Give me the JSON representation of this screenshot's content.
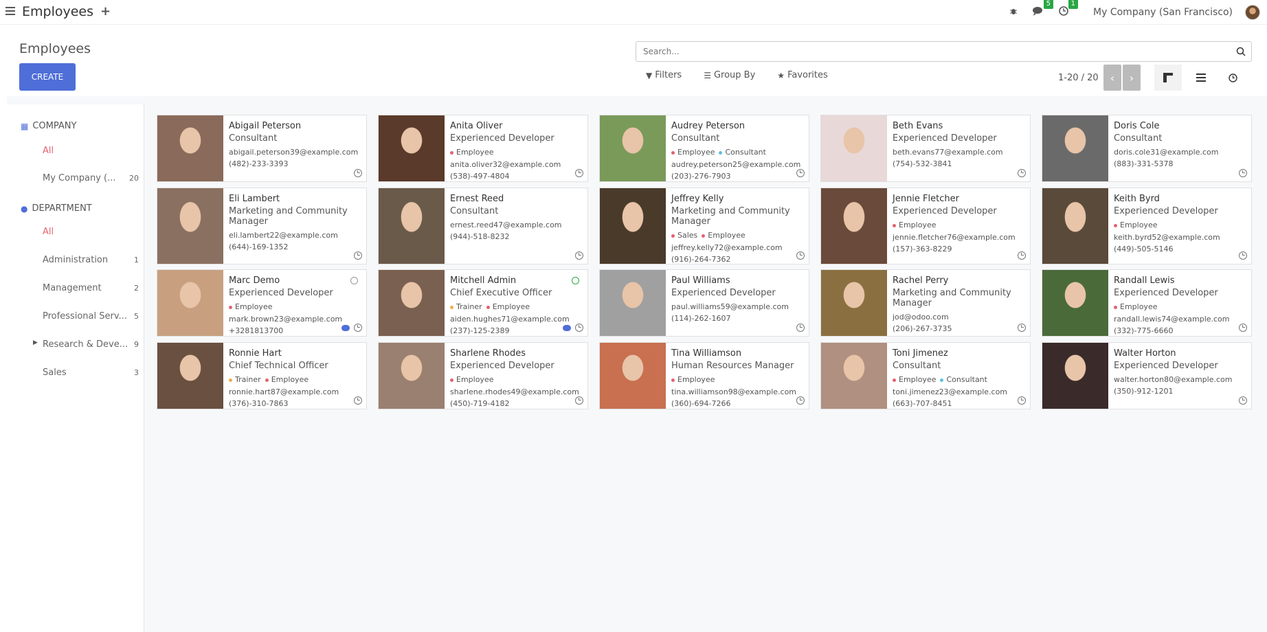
{
  "topbar": {
    "app_title": "Employees",
    "messages_badge": "5",
    "activities_badge": "1",
    "company": "My Company (San Francisco)"
  },
  "control": {
    "title": "Employees",
    "create_label": "CREATE",
    "search_placeholder": "Search...",
    "filters_label": "Filters",
    "groupby_label": "Group By",
    "favorites_label": "Favorites",
    "pager": "1-20 / 20"
  },
  "sidebar": {
    "company_head": "COMPANY",
    "company_all": "All",
    "company_item": "My Company (...",
    "company_item_count": "20",
    "department_head": "DEPARTMENT",
    "department_all": "All",
    "departments": [
      {
        "label": "Administration",
        "count": "1"
      },
      {
        "label": "Management",
        "count": "2"
      },
      {
        "label": "Professional Serv...",
        "count": "5"
      },
      {
        "label": "Research & Deve...",
        "count": "9"
      },
      {
        "label": "Sales",
        "count": "3"
      }
    ]
  },
  "colors": {
    "accent": "#4f6ed8",
    "active": "#e4626f",
    "tag_employee": "#e4626f",
    "tag_consultant": "#5bc0de",
    "tag_sales": "#e4626f",
    "tag_trainer": "#f0ad4e"
  },
  "employees": [
    {
      "name": "Abigail Peterson",
      "job": "Consultant",
      "tags": [],
      "email": "abigail.peterson39@example.com",
      "phone": "(482)-233-3393",
      "photo_color": "#8a6a5a"
    },
    {
      "name": "Anita Oliver",
      "job": "Experienced Developer",
      "tags": [
        {
          "label": "Employee",
          "color": "#e4626f"
        }
      ],
      "email": "anita.oliver32@example.com",
      "phone": "(538)-497-4804",
      "photo_color": "#5a3a2a"
    },
    {
      "name": "Audrey Peterson",
      "job": "Consultant",
      "tags": [
        {
          "label": "Employee",
          "color": "#e4626f"
        },
        {
          "label": "Consultant",
          "color": "#5bc0de"
        }
      ],
      "email": "audrey.peterson25@example.com",
      "phone": "(203)-276-7903",
      "photo_color": "#7a9a5a"
    },
    {
      "name": "Beth Evans",
      "job": "Experienced Developer",
      "tags": [],
      "email": "beth.evans77@example.com",
      "phone": "(754)-532-3841",
      "photo_color": "#e8d8d8"
    },
    {
      "name": "Doris Cole",
      "job": "Consultant",
      "tags": [],
      "email": "doris.cole31@example.com",
      "phone": "(883)-331-5378",
      "photo_color": "#6a6a6a"
    },
    {
      "name": "Eli Lambert",
      "job": "Marketing and Community Manager",
      "tags": [],
      "email": "eli.lambert22@example.com",
      "phone": "(644)-169-1352",
      "photo_color": "#8a7060"
    },
    {
      "name": "Ernest Reed",
      "job": "Consultant",
      "tags": [],
      "email": "ernest.reed47@example.com",
      "phone": "(944)-518-8232",
      "photo_color": "#6a5a4a"
    },
    {
      "name": "Jeffrey Kelly",
      "job": "Marketing and Community Manager",
      "tags": [
        {
          "label": "Sales",
          "color": "#e4626f"
        },
        {
          "label": "Employee",
          "color": "#e4626f"
        }
      ],
      "email": "jeffrey.kelly72@example.com",
      "phone": "(916)-264-7362",
      "photo_color": "#4a3a2a"
    },
    {
      "name": "Jennie Fletcher",
      "job": "Experienced Developer",
      "tags": [
        {
          "label": "Employee",
          "color": "#e4626f"
        }
      ],
      "email": "jennie.fletcher76@example.com",
      "phone": "(157)-363-8229",
      "photo_color": "#6a4a3a"
    },
    {
      "name": "Keith Byrd",
      "job": "Experienced Developer",
      "tags": [
        {
          "label": "Employee",
          "color": "#e4626f"
        }
      ],
      "email": "keith.byrd52@example.com",
      "phone": "(449)-505-5146",
      "photo_color": "#5a4a3a"
    },
    {
      "name": "Marc Demo",
      "job": "Experienced Developer",
      "tags": [
        {
          "label": "Employee",
          "color": "#e4626f"
        }
      ],
      "email": "mark.brown23@example.com",
      "phone": "+3281813700",
      "photo_color": "#c8a080",
      "status": "offline",
      "chat": true
    },
    {
      "name": "Mitchell Admin",
      "job": "Chief Executive Officer",
      "tags": [
        {
          "label": "Trainer",
          "color": "#f0ad4e"
        },
        {
          "label": "Employee",
          "color": "#e4626f"
        }
      ],
      "email": "aiden.hughes71@example.com",
      "phone": "(237)-125-2389",
      "photo_color": "#7a6050",
      "status": "online",
      "chat": true
    },
    {
      "name": "Paul Williams",
      "job": "Experienced Developer",
      "tags": [],
      "email": "paul.williams59@example.com",
      "phone": "(114)-262-1607",
      "photo_color": "#a0a0a0"
    },
    {
      "name": "Rachel Perry",
      "job": "Marketing and Community Manager",
      "tags": [],
      "email": "jod@odoo.com",
      "phone": "(206)-267-3735",
      "photo_color": "#8a7040"
    },
    {
      "name": "Randall Lewis",
      "job": "Experienced Developer",
      "tags": [
        {
          "label": "Employee",
          "color": "#e4626f"
        }
      ],
      "email": "randall.lewis74@example.com",
      "phone": "(332)-775-6660",
      "photo_color": "#4a6a3a"
    },
    {
      "name": "Ronnie Hart",
      "job": "Chief Technical Officer",
      "tags": [
        {
          "label": "Trainer",
          "color": "#f0ad4e"
        },
        {
          "label": "Employee",
          "color": "#e4626f"
        }
      ],
      "email": "ronnie.hart87@example.com",
      "phone": "(376)-310-7863",
      "photo_color": "#6a5040"
    },
    {
      "name": "Sharlene Rhodes",
      "job": "Experienced Developer",
      "tags": [
        {
          "label": "Employee",
          "color": "#e4626f"
        }
      ],
      "email": "sharlene.rhodes49@example.com",
      "phone": "(450)-719-4182",
      "photo_color": "#9a8070"
    },
    {
      "name": "Tina Williamson",
      "job": "Human Resources Manager",
      "tags": [
        {
          "label": "Employee",
          "color": "#e4626f"
        }
      ],
      "email": "tina.williamson98@example.com",
      "phone": "(360)-694-7266",
      "photo_color": "#c87050"
    },
    {
      "name": "Toni Jimenez",
      "job": "Consultant",
      "tags": [
        {
          "label": "Employee",
          "color": "#e4626f"
        },
        {
          "label": "Consultant",
          "color": "#5bc0de"
        }
      ],
      "email": "toni.jimenez23@example.com",
      "phone": "(663)-707-8451",
      "photo_color": "#b09080"
    },
    {
      "name": "Walter Horton",
      "job": "Experienced Developer",
      "tags": [],
      "email": "walter.horton80@example.com",
      "phone": "(350)-912-1201",
      "photo_color": "#3a2a2a"
    }
  ]
}
